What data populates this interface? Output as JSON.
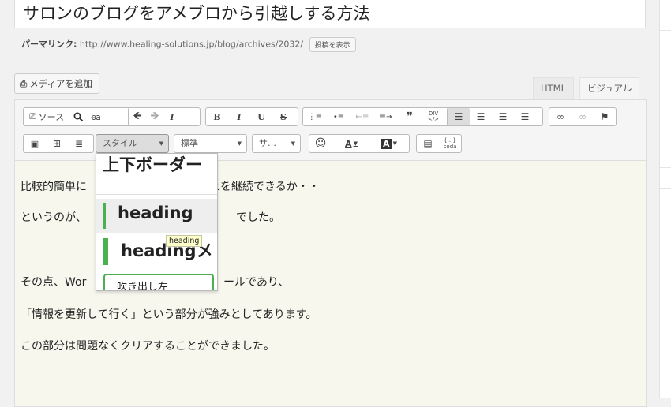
{
  "post": {
    "title": "サロンのブログをアメブロから引越しする方法",
    "permalink_label": "パーマリンク:",
    "permalink_url": "http://www.healing-solutions.jp/blog/archives/2032/",
    "view_post_button": "投稿を表示"
  },
  "media": {
    "add_media_label": "メディアを追加"
  },
  "tabs": [
    {
      "label": "HTML"
    },
    {
      "label": "ビジュアル"
    }
  ],
  "toolbar": {
    "source_label": "ソース",
    "style_select": "スタイル",
    "format_select": "標準",
    "font_select": "サ…"
  },
  "content": {
    "paragraphs": [
      "比較的簡単に",
      "れを継続できるか・・",
      "というのが、",
      "でした。",
      "その点、Wor",
      "ールであり、",
      "「情報を更新して行く」という部分が強みとしてあります。",
      "この部分は問題なくクリアすることができました。"
    ]
  },
  "style_dropdown": {
    "items": [
      {
        "label": "上下ボーダー"
      },
      {
        "label": "heading"
      },
      {
        "label": "headingメ"
      },
      {
        "label": "吹き出し左"
      }
    ],
    "tooltip": "heading"
  },
  "colors": {
    "accent_green": "#4caf50",
    "content_bg": "#f7f7ee"
  }
}
